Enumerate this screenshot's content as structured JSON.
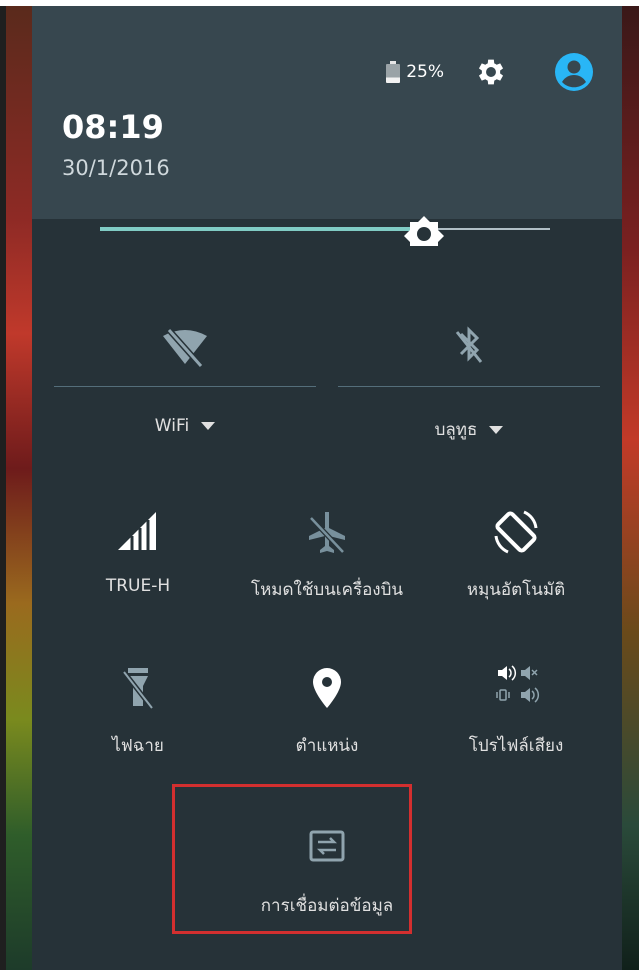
{
  "status": {
    "battery_level": 0.72,
    "battery_text": "25%",
    "icons": [
      "battery-icon",
      "gear-icon",
      "account-icon"
    ]
  },
  "clock": {
    "time": "08:19",
    "date": "30/1/2016"
  },
  "brightness": {
    "level": 0.72
  },
  "big_toggles": [
    {
      "label": "WiFi",
      "icon": "wifi-off-icon",
      "state": "off"
    },
    {
      "label": "บลูทูธ",
      "icon": "bluetooth-off-icon",
      "state": "off"
    }
  ],
  "tiles": [
    {
      "label": "TRUE-H",
      "icon": "cellular-signal-icon"
    },
    {
      "label": "โหมดใช้บนเครื่องบิน",
      "icon": "airplane-off-icon"
    },
    {
      "label": "หมุนอัตโนมัติ",
      "icon": "auto-rotate-icon"
    },
    {
      "label": "ไฟฉาย",
      "icon": "flashlight-off-icon"
    },
    {
      "label": "ตำแหน่ง",
      "icon": "location-icon"
    },
    {
      "label": "โปรไฟล์เสียง",
      "icon": "sound-profile-icon"
    },
    {
      "label": "การเชื่อมต่อข้อมูล",
      "icon": "data-connection-icon"
    }
  ],
  "colors": {
    "panel_bg": "#263238",
    "header_bg": "#37474f",
    "accent": "#80cbc4",
    "avatar": "#29b6f6",
    "highlight": "#d32f2f"
  }
}
